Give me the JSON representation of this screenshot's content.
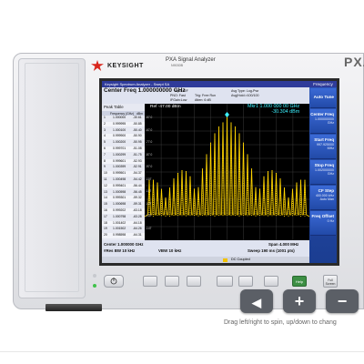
{
  "instrument": {
    "brand": "KEYSIGHT",
    "model": "PXA Signal Analyzer",
    "model_sub": "N9030B",
    "model_big": "PXA"
  },
  "screen": {
    "window_title": "Keysight Spectrum Analyzer - Swept SA",
    "center_freq_label": "Center Freq 1.000000000 GHz",
    "top_info": {
      "input": "Input: RF",
      "pno": "PNO: Fast",
      "ifgain": "IFGain:Low",
      "trig": "Trig: Free Run",
      "atten": "Atten: 6 dB",
      "avg_type": "Avg Type: Log-Pwr",
      "avg_hold": "Avg|Hold:>100/100"
    },
    "peak_table": {
      "title": "Peak Table",
      "col_freq": "Frequency (GHz)",
      "col_amp": "dBm",
      "rows": [
        {
          "n": "1",
          "freq": "1.000000",
          "amp": "-30.61"
        },
        {
          "n": "2",
          "freq": "0.999995",
          "amp": "-50.85"
        },
        {
          "n": "3",
          "freq": "1.000100",
          "amp": "-50.40"
        },
        {
          "n": "4",
          "freq": "0.999900",
          "amp": "-50.90"
        },
        {
          "n": "5",
          "freq": "1.000200",
          "amp": "-50.95"
        },
        {
          "n": "6",
          "freq": "0.999701",
          "amp": "-51.08"
        },
        {
          "n": "7",
          "freq": "1.000299",
          "amp": "-51.75"
        },
        {
          "n": "8",
          "freq": "0.999601",
          "amp": "-52.93"
        },
        {
          "n": "9",
          "freq": "1.000399",
          "amp": "-52.91"
        },
        {
          "n": "10",
          "freq": "0.999501",
          "amp": "-54.37"
        },
        {
          "n": "11",
          "freq": "1.000498",
          "amp": "-54.42"
        },
        {
          "n": "12",
          "freq": "0.999401",
          "amp": "-56.44"
        },
        {
          "n": "13",
          "freq": "1.000598",
          "amp": "-56.45"
        },
        {
          "n": "14",
          "freq": "0.999301",
          "amp": "-59.32"
        },
        {
          "n": "15",
          "freq": "1.000698",
          "amp": "-59.31"
        },
        {
          "n": "16",
          "freq": "0.999202",
          "amp": "-63.18"
        },
        {
          "n": "17",
          "freq": "1.000798",
          "amp": "-63.28"
        },
        {
          "n": "18",
          "freq": "1.001402",
          "amp": "-64.18"
        },
        {
          "n": "19",
          "freq": "1.001502",
          "amp": "-64.26"
        },
        {
          "n": "20",
          "freq": "0.998598",
          "amp": "-64.31"
        }
      ]
    },
    "plot": {
      "ref_level": "Ref -47.00 dBm",
      "marker_label": "Mkr1 1.000 000 00 GHz",
      "marker_value": "-30.304 dBm",
      "y_ticks": [
        "-57.0",
        "-67.0",
        "-77.0",
        "-87.0",
        "-97.0",
        "-107",
        "-117",
        "-127",
        "-137",
        "-147"
      ],
      "scale": "10 dB/div"
    },
    "bottom_info": {
      "center": "Center 1.000000 GHz",
      "rbw": "#Res BW 10 kHz",
      "vbw": "VBW 10 kHz",
      "span": "Span 4.000 MHz",
      "sweep": "Sweep  190 ms (1001 pts)"
    },
    "status": "DC Coupled",
    "menu_title": "Frequency",
    "softkeys": [
      {
        "label": "Auto Tune",
        "value": ""
      },
      {
        "label": "Center Freq",
        "value": "1.000000000 GHz"
      },
      {
        "label": "Start Freq",
        "value": "997.925000 MHz"
      },
      {
        "label": "Stop Freq",
        "value": "1.002000000 GHz"
      },
      {
        "label": "CF Step",
        "value": "400.000 kHz  Auto  Man"
      },
      {
        "label": "Freq Offset",
        "value": "0 Hz"
      }
    ]
  },
  "front_panel": {
    "help_label": "Help",
    "full_screen_label": "Full Screen"
  },
  "controls": {
    "left_symbol": "◀",
    "plus_symbol": "+",
    "minus_symbol": "−",
    "hint": "Drag left/right to spin, up/down to chang"
  },
  "colors": {
    "trace": "#ffd400",
    "screen_bg": "#000000",
    "softkey_blue": "#224aa8",
    "marker_cyan": "#3cf2ff"
  }
}
